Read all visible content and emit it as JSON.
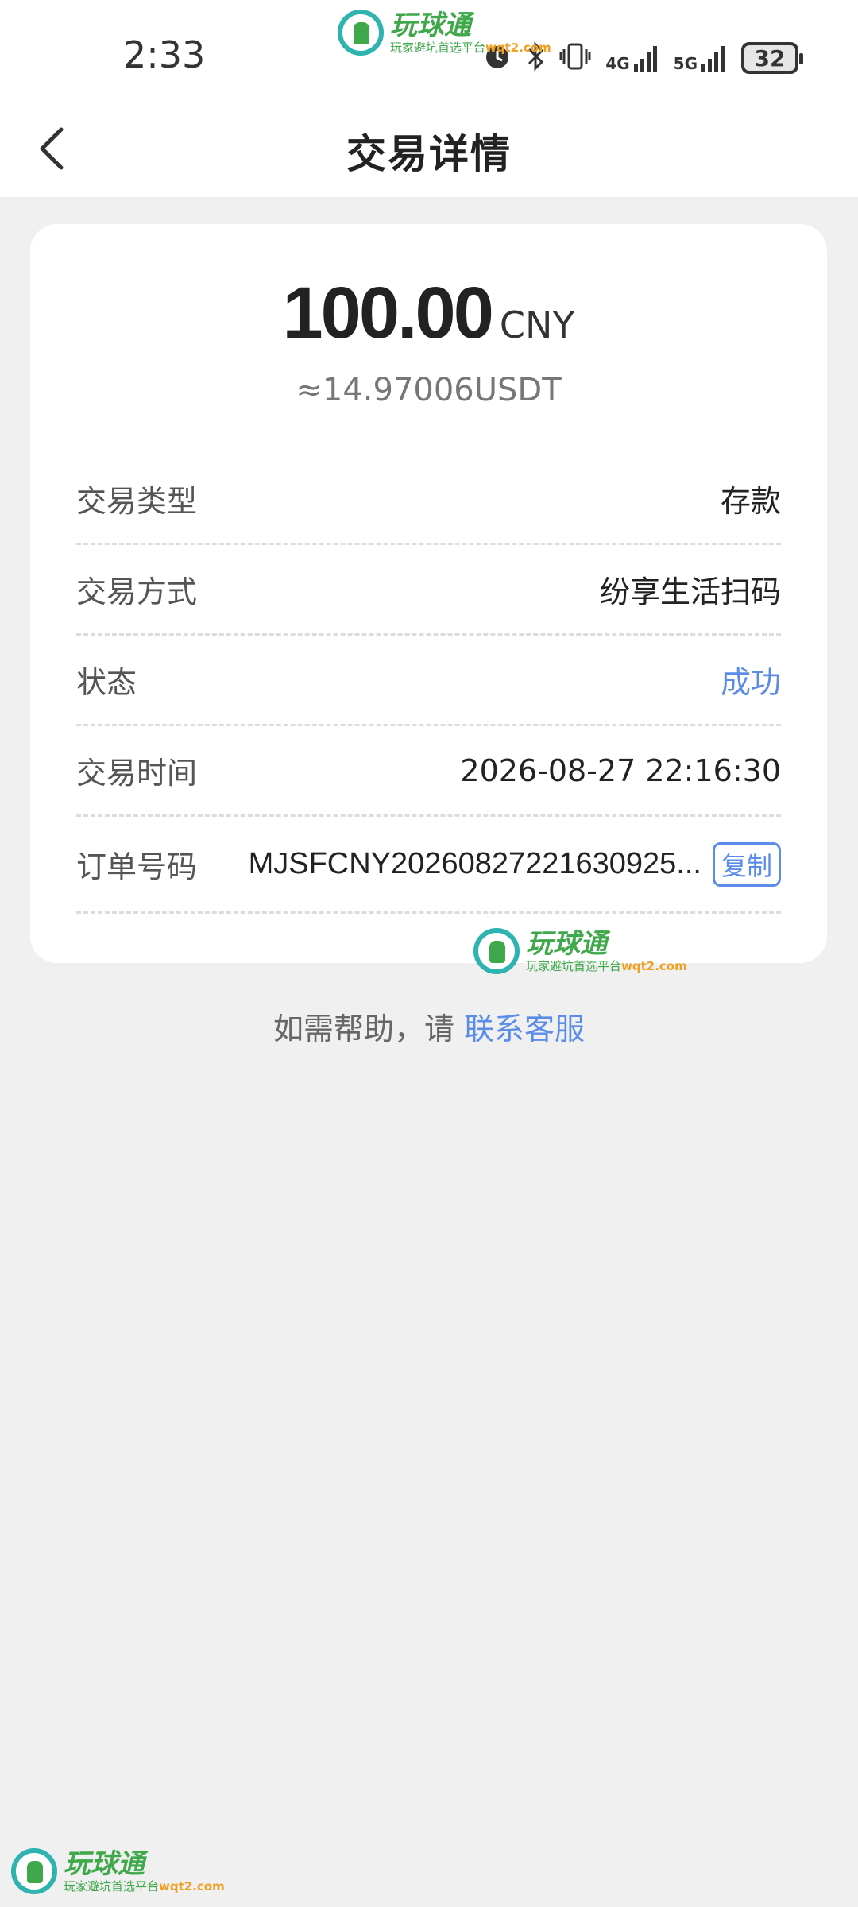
{
  "status_bar": {
    "time": "2:33",
    "network_1": "4G",
    "network_2": "5G",
    "battery": "32"
  },
  "header": {
    "title": "交易详情"
  },
  "summary": {
    "amount": "100.00",
    "currency": "CNY",
    "usdt": "≈14.97006USDT"
  },
  "details": {
    "type_label": "交易类型",
    "type_value": "存款",
    "method_label": "交易方式",
    "method_value": "纷享生活扫码",
    "status_label": "状态",
    "status_value": "成功",
    "time_label": "交易时间",
    "time_value": "2026-08-27 22:16:30",
    "order_label": "订单号码",
    "order_value": "MJSFCNY20260827221630925...",
    "copy_label": "复制"
  },
  "help": {
    "text": "如需帮助，请 ",
    "link": "联系客服"
  },
  "watermark": {
    "brand": "玩球通",
    "sub": "玩家避坑首选平台",
    "domain": "wqt2.com"
  },
  "colors": {
    "accent": "#5b8de8",
    "background": "#f0f0f0",
    "watermark_green": "#3fa84a",
    "watermark_orange": "#f0a020"
  }
}
